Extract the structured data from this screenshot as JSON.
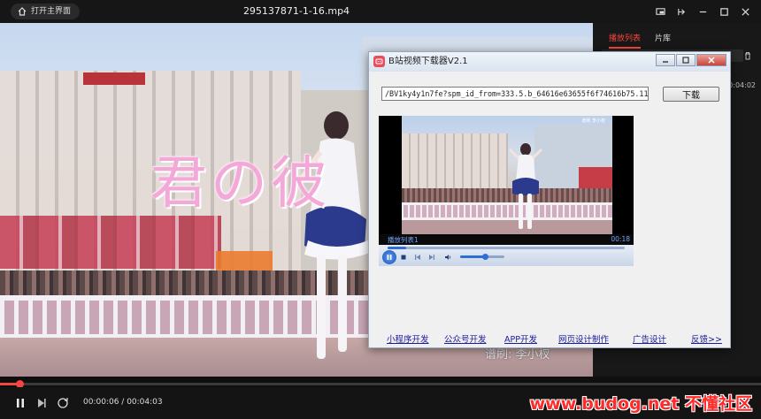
{
  "player": {
    "home_button": "打开主界面",
    "file_title": "295137871-1-16.mp4",
    "time_current": "00:00:06",
    "time_separator": " / ",
    "time_total": "00:04:03",
    "progress": 0.025,
    "accent_color": "#f5473f"
  },
  "video_overlay": {
    "big_text": "君の彼",
    "subtitle": "谱刷:  李小杈"
  },
  "side_panel": {
    "tabs": [
      {
        "label": "播放列表",
        "active": true
      },
      {
        "label": "片库",
        "active": false
      }
    ],
    "item_time": "0:04:02"
  },
  "dialog": {
    "title": "B站视频下载器V2.1",
    "url_value": "/BV1ky4y1n7fe?spm_id_from=333.5.b_64616e63655f6f74616b75.11",
    "download_button": "下载",
    "preview": {
      "playlist_label": "播放列表1",
      "time": "00:18",
      "seek_progress": 0.08,
      "volume": 0.55,
      "overlay_text": "谱刷 李小杈"
    },
    "links": [
      "小程序开发",
      "公众号开发",
      "APP开发",
      "网页设计制作",
      "广告设计",
      "反馈>>"
    ]
  },
  "watermark": "www.budog.net 不懂社区"
}
